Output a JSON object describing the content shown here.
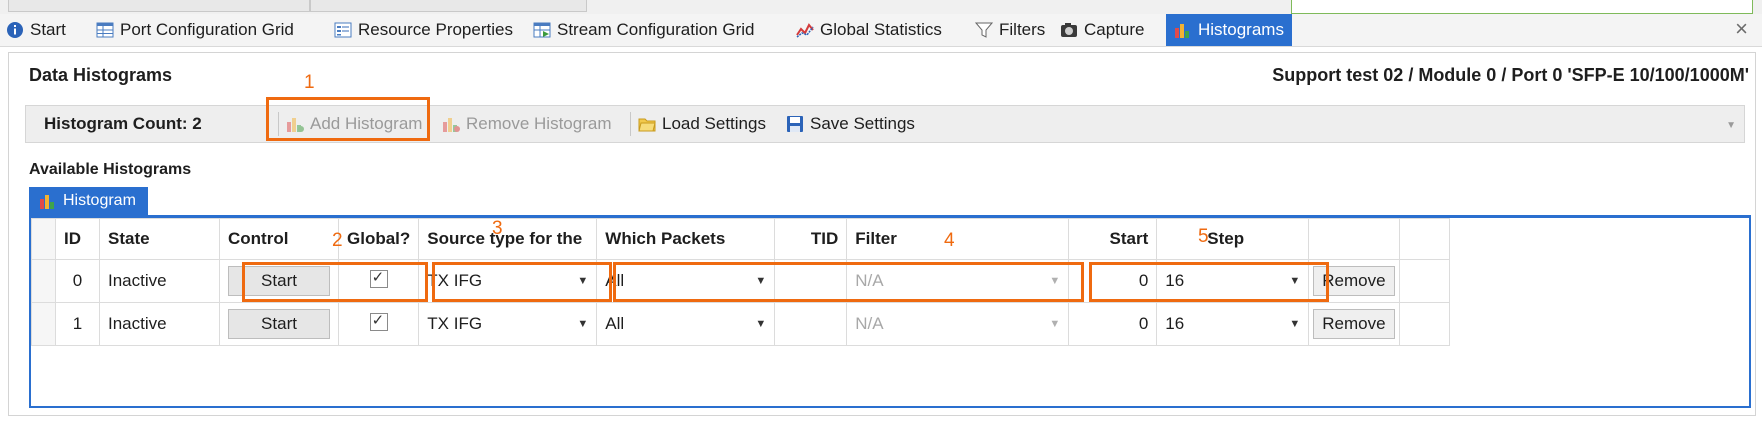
{
  "tabs": [
    {
      "label": "Start",
      "icon": "info-icon",
      "active": false
    },
    {
      "label": "Port Configuration Grid",
      "icon": "grid-icon",
      "active": false
    },
    {
      "label": "Resource Properties",
      "icon": "properties-icon",
      "active": false
    },
    {
      "label": "Stream Configuration Grid",
      "icon": "stream-grid-icon",
      "active": false
    },
    {
      "label": "Global Statistics",
      "icon": "line-chart-icon",
      "active": false
    },
    {
      "label": "Filters",
      "icon": "filter-icon",
      "active": false
    },
    {
      "label": "Capture",
      "icon": "camera-icon",
      "active": false
    },
    {
      "label": "Histograms",
      "icon": "histogram-icon",
      "active": true
    }
  ],
  "close_glyph": "×",
  "panel": {
    "title": "Data Histograms",
    "port_path": "Support test 02 / Module 0 / Port 0 'SFP-E 10/100/1000M'"
  },
  "toolbar": {
    "count_label": "Histogram Count: 2",
    "add": "Add Histogram",
    "remove": "Remove Histogram",
    "load": "Load Settings",
    "save": "Save Settings"
  },
  "available_label": "Available Histograms",
  "grid_tab": "Histogram",
  "columns": {
    "id": "ID",
    "state": "State",
    "control": "Control",
    "global": "Global?",
    "source": "Source type for the",
    "which": "Which Packets",
    "tid": "TID",
    "filter": "Filter",
    "start": "Start",
    "step": "Step"
  },
  "rows": [
    {
      "id": "0",
      "state": "Inactive",
      "control": "Start",
      "global": true,
      "source": "TX IFG",
      "which": "All",
      "tid": "",
      "filter": "N/A",
      "start": "0",
      "step": "16",
      "remove": "Remove"
    },
    {
      "id": "1",
      "state": "Inactive",
      "control": "Start",
      "global": true,
      "source": "TX IFG",
      "which": "All",
      "tid": "",
      "filter": "N/A",
      "start": "0",
      "step": "16",
      "remove": "Remove"
    }
  ],
  "annotations": [
    "1",
    "2",
    "3",
    "4",
    "5"
  ],
  "colors": {
    "accent": "#2a6fcf",
    "annotation": "#ef6a10"
  }
}
